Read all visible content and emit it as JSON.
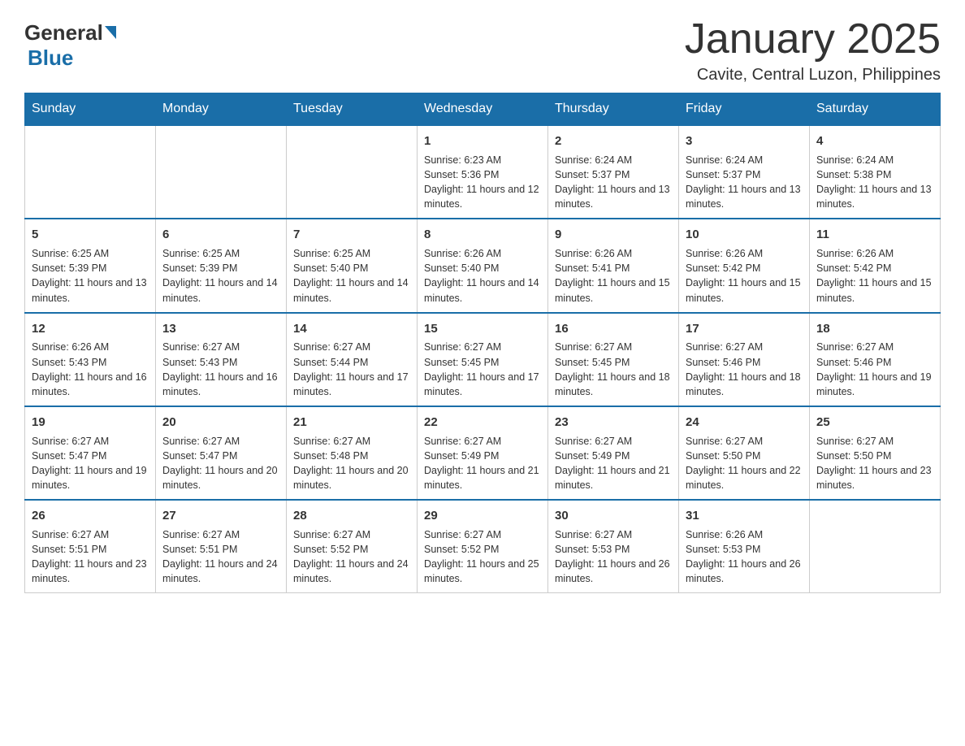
{
  "header": {
    "logo_general": "General",
    "logo_blue": "Blue",
    "month_year": "January 2025",
    "location": "Cavite, Central Luzon, Philippines"
  },
  "days_of_week": [
    "Sunday",
    "Monday",
    "Tuesday",
    "Wednesday",
    "Thursday",
    "Friday",
    "Saturday"
  ],
  "weeks": [
    [
      {
        "day": "",
        "info": ""
      },
      {
        "day": "",
        "info": ""
      },
      {
        "day": "",
        "info": ""
      },
      {
        "day": "1",
        "info": "Sunrise: 6:23 AM\nSunset: 5:36 PM\nDaylight: 11 hours and 12 minutes."
      },
      {
        "day": "2",
        "info": "Sunrise: 6:24 AM\nSunset: 5:37 PM\nDaylight: 11 hours and 13 minutes."
      },
      {
        "day": "3",
        "info": "Sunrise: 6:24 AM\nSunset: 5:37 PM\nDaylight: 11 hours and 13 minutes."
      },
      {
        "day": "4",
        "info": "Sunrise: 6:24 AM\nSunset: 5:38 PM\nDaylight: 11 hours and 13 minutes."
      }
    ],
    [
      {
        "day": "5",
        "info": "Sunrise: 6:25 AM\nSunset: 5:39 PM\nDaylight: 11 hours and 13 minutes."
      },
      {
        "day": "6",
        "info": "Sunrise: 6:25 AM\nSunset: 5:39 PM\nDaylight: 11 hours and 14 minutes."
      },
      {
        "day": "7",
        "info": "Sunrise: 6:25 AM\nSunset: 5:40 PM\nDaylight: 11 hours and 14 minutes."
      },
      {
        "day": "8",
        "info": "Sunrise: 6:26 AM\nSunset: 5:40 PM\nDaylight: 11 hours and 14 minutes."
      },
      {
        "day": "9",
        "info": "Sunrise: 6:26 AM\nSunset: 5:41 PM\nDaylight: 11 hours and 15 minutes."
      },
      {
        "day": "10",
        "info": "Sunrise: 6:26 AM\nSunset: 5:42 PM\nDaylight: 11 hours and 15 minutes."
      },
      {
        "day": "11",
        "info": "Sunrise: 6:26 AM\nSunset: 5:42 PM\nDaylight: 11 hours and 15 minutes."
      }
    ],
    [
      {
        "day": "12",
        "info": "Sunrise: 6:26 AM\nSunset: 5:43 PM\nDaylight: 11 hours and 16 minutes."
      },
      {
        "day": "13",
        "info": "Sunrise: 6:27 AM\nSunset: 5:43 PM\nDaylight: 11 hours and 16 minutes."
      },
      {
        "day": "14",
        "info": "Sunrise: 6:27 AM\nSunset: 5:44 PM\nDaylight: 11 hours and 17 minutes."
      },
      {
        "day": "15",
        "info": "Sunrise: 6:27 AM\nSunset: 5:45 PM\nDaylight: 11 hours and 17 minutes."
      },
      {
        "day": "16",
        "info": "Sunrise: 6:27 AM\nSunset: 5:45 PM\nDaylight: 11 hours and 18 minutes."
      },
      {
        "day": "17",
        "info": "Sunrise: 6:27 AM\nSunset: 5:46 PM\nDaylight: 11 hours and 18 minutes."
      },
      {
        "day": "18",
        "info": "Sunrise: 6:27 AM\nSunset: 5:46 PM\nDaylight: 11 hours and 19 minutes."
      }
    ],
    [
      {
        "day": "19",
        "info": "Sunrise: 6:27 AM\nSunset: 5:47 PM\nDaylight: 11 hours and 19 minutes."
      },
      {
        "day": "20",
        "info": "Sunrise: 6:27 AM\nSunset: 5:47 PM\nDaylight: 11 hours and 20 minutes."
      },
      {
        "day": "21",
        "info": "Sunrise: 6:27 AM\nSunset: 5:48 PM\nDaylight: 11 hours and 20 minutes."
      },
      {
        "day": "22",
        "info": "Sunrise: 6:27 AM\nSunset: 5:49 PM\nDaylight: 11 hours and 21 minutes."
      },
      {
        "day": "23",
        "info": "Sunrise: 6:27 AM\nSunset: 5:49 PM\nDaylight: 11 hours and 21 minutes."
      },
      {
        "day": "24",
        "info": "Sunrise: 6:27 AM\nSunset: 5:50 PM\nDaylight: 11 hours and 22 minutes."
      },
      {
        "day": "25",
        "info": "Sunrise: 6:27 AM\nSunset: 5:50 PM\nDaylight: 11 hours and 23 minutes."
      }
    ],
    [
      {
        "day": "26",
        "info": "Sunrise: 6:27 AM\nSunset: 5:51 PM\nDaylight: 11 hours and 23 minutes."
      },
      {
        "day": "27",
        "info": "Sunrise: 6:27 AM\nSunset: 5:51 PM\nDaylight: 11 hours and 24 minutes."
      },
      {
        "day": "28",
        "info": "Sunrise: 6:27 AM\nSunset: 5:52 PM\nDaylight: 11 hours and 24 minutes."
      },
      {
        "day": "29",
        "info": "Sunrise: 6:27 AM\nSunset: 5:52 PM\nDaylight: 11 hours and 25 minutes."
      },
      {
        "day": "30",
        "info": "Sunrise: 6:27 AM\nSunset: 5:53 PM\nDaylight: 11 hours and 26 minutes."
      },
      {
        "day": "31",
        "info": "Sunrise: 6:26 AM\nSunset: 5:53 PM\nDaylight: 11 hours and 26 minutes."
      },
      {
        "day": "",
        "info": ""
      }
    ]
  ]
}
